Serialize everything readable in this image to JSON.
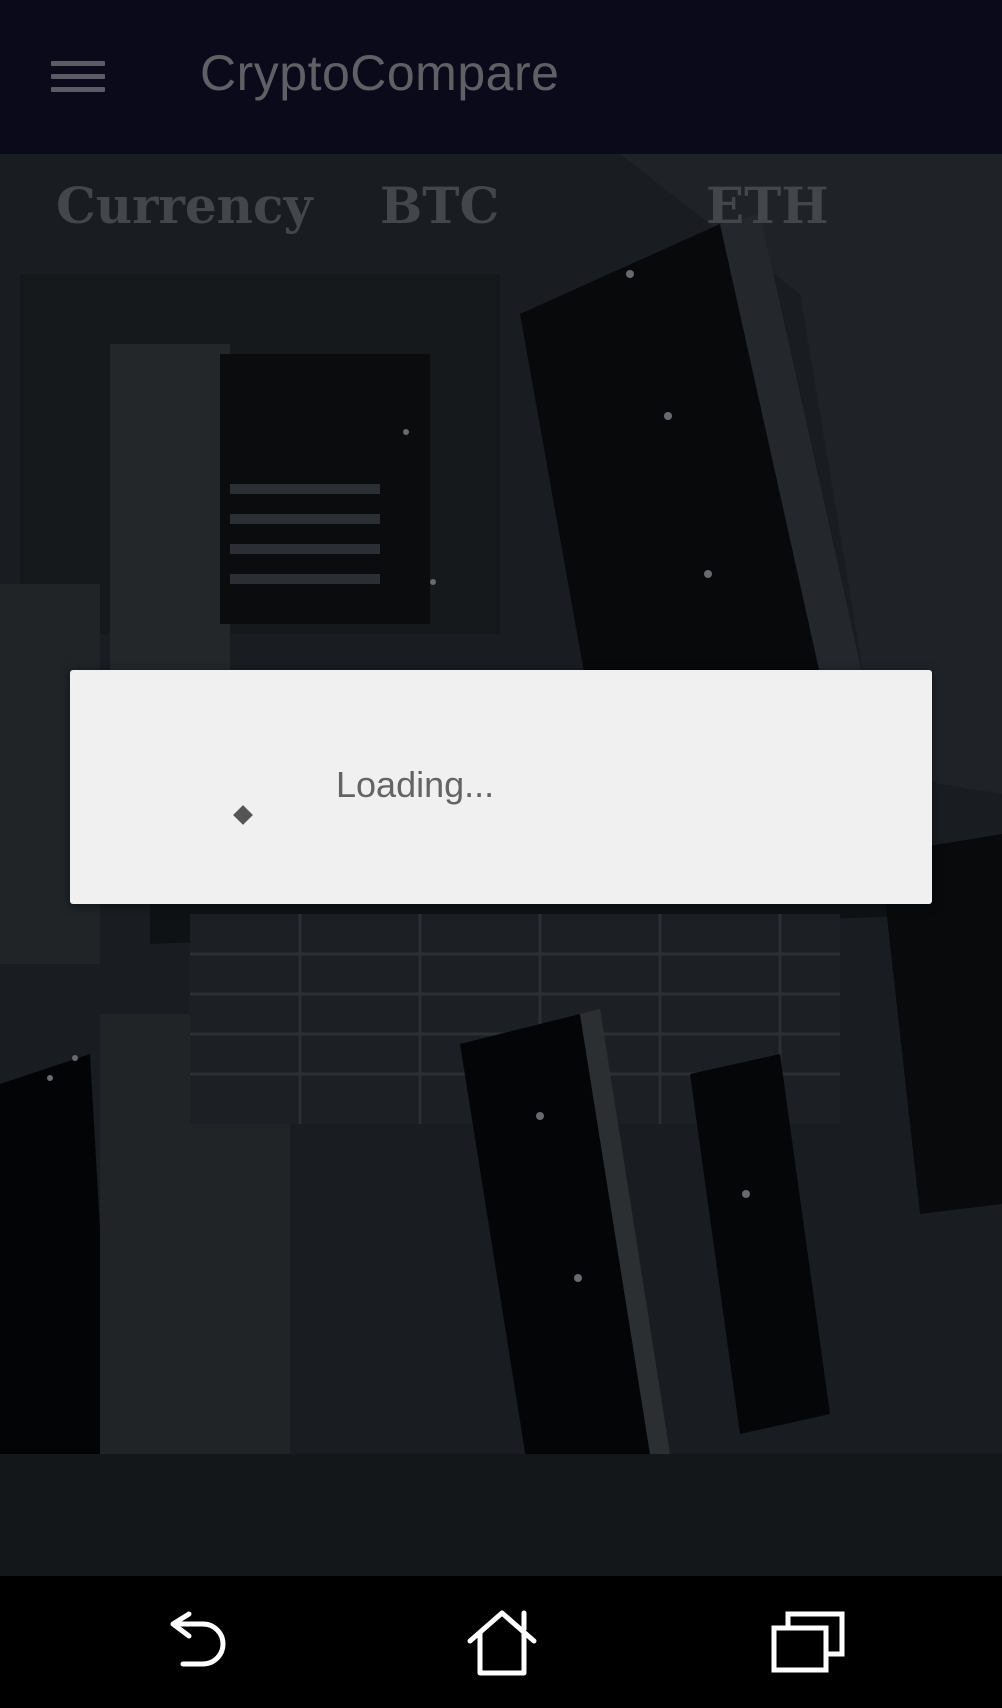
{
  "app_bar": {
    "title": "CryptoCompare",
    "menu_icon": "hamburger-menu-icon"
  },
  "table_header": {
    "currency": "Currency",
    "btc": "BTC",
    "eth": "ETH"
  },
  "dialog": {
    "loading_text": "Loading...",
    "spinner_icon": "progress-spinner-icon"
  },
  "nav_bar": {
    "back_icon": "back-icon",
    "home_icon": "home-icon",
    "recents_icon": "recents-icon"
  },
  "colors": {
    "app_bar_bg": "#0a0a1b",
    "dialog_bg": "#f0f0f0",
    "nav_bar_bg": "#000000",
    "text_muted": "#5f5f66"
  }
}
